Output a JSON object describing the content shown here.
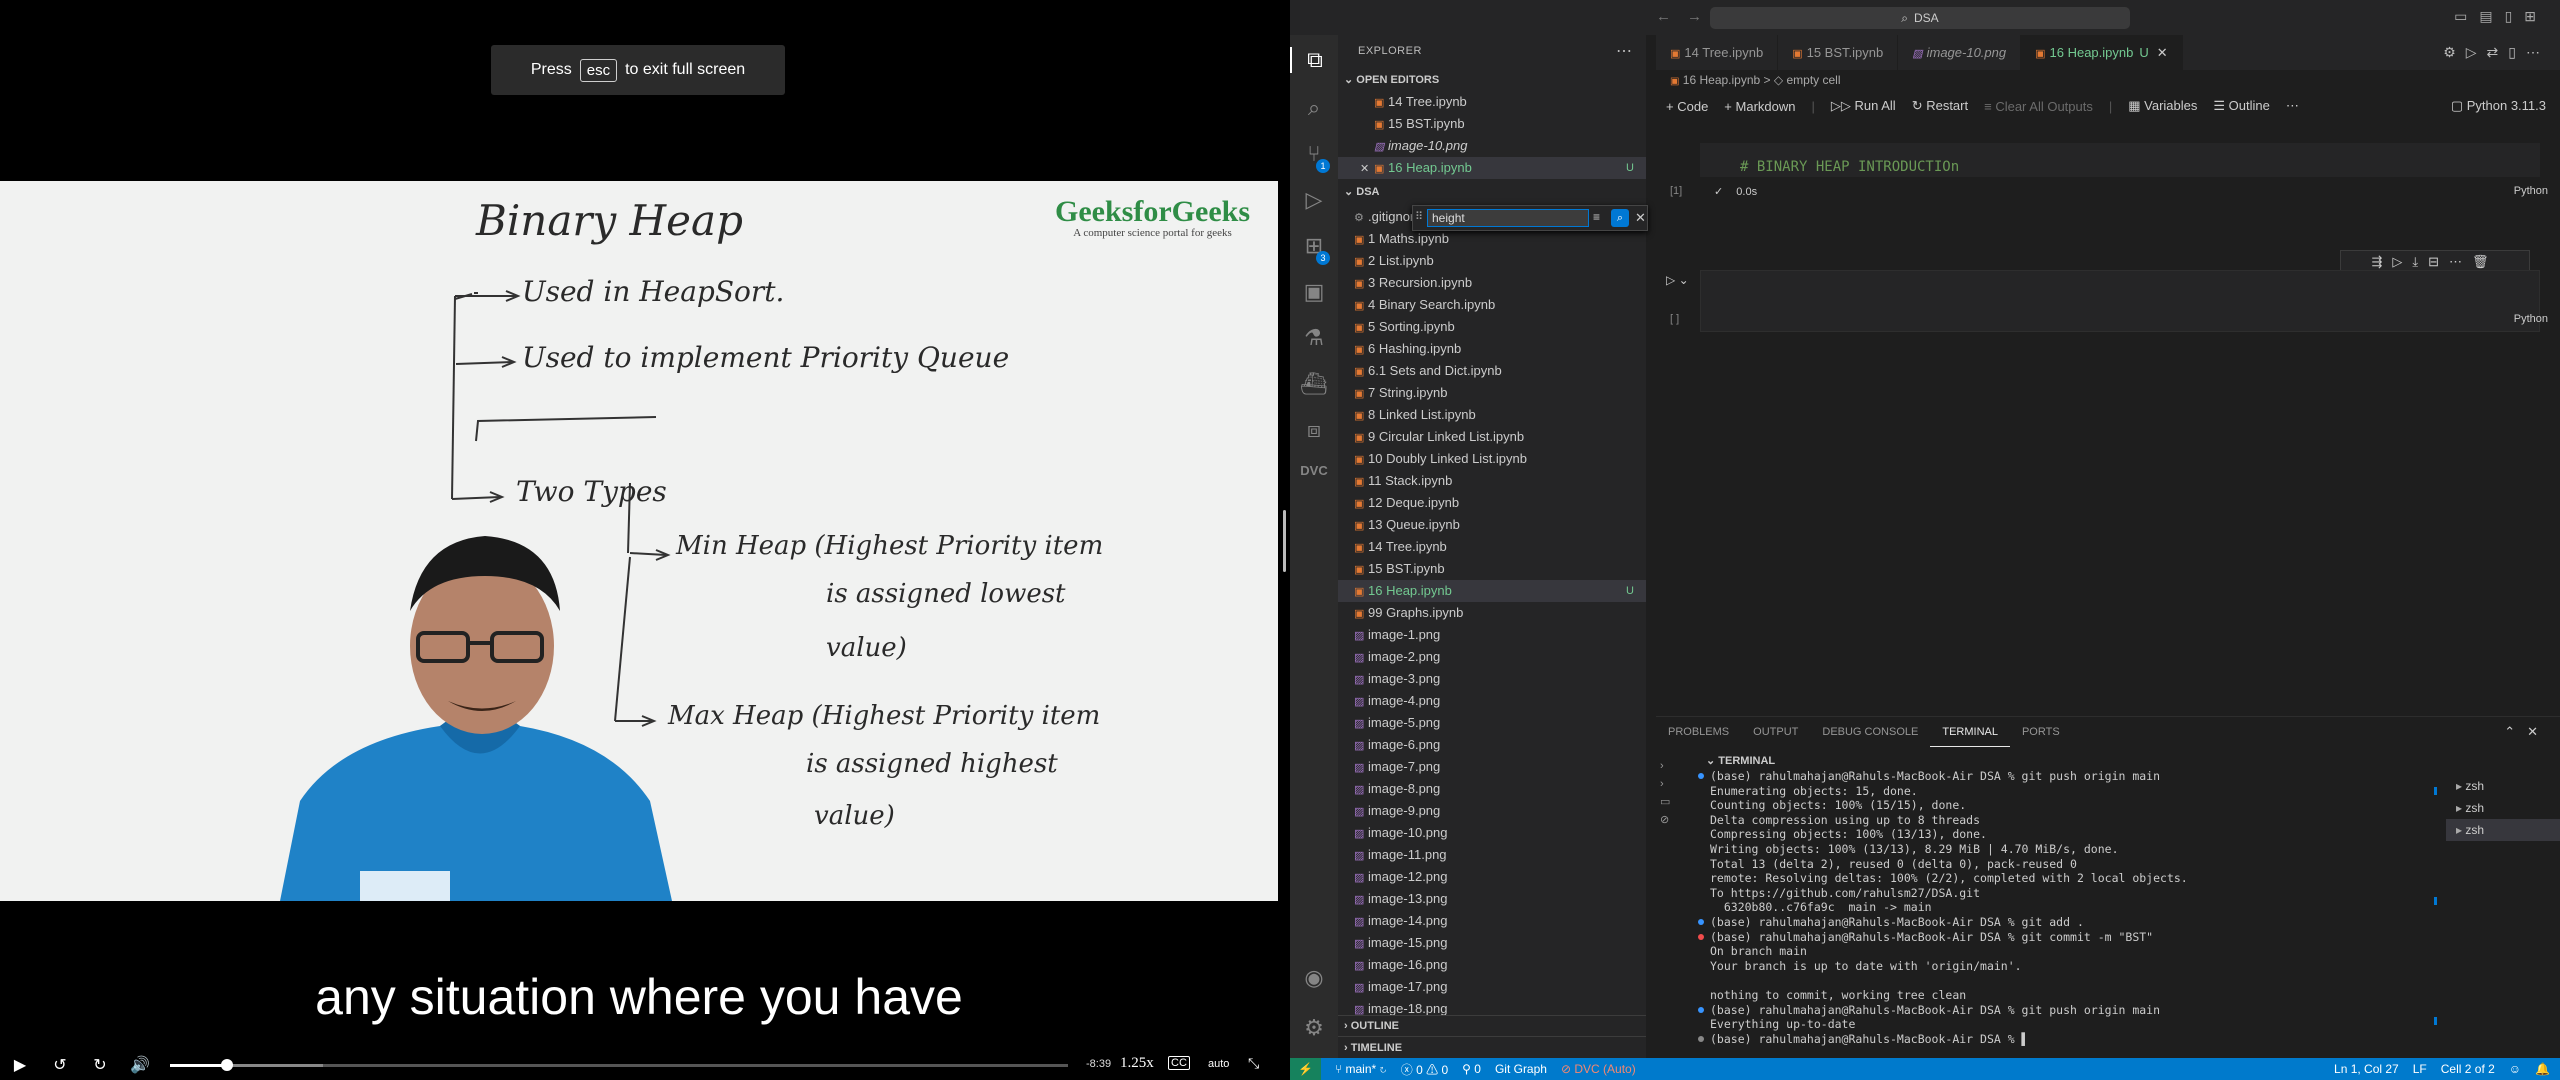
{
  "player": {
    "esc_prefix": "Press",
    "esc_key": "esc",
    "esc_suffix": "to exit full screen",
    "brand_name": "GeeksforGeeks",
    "brand_tagline": "A computer science portal for geeks",
    "whiteboard": {
      "title": "Binary Heap",
      "line1": "Used in HeapSort.",
      "line2": "Used to implement Priority Queue",
      "line3": "Two Types",
      "min_heap_1": "Min Heap (Highest Priority item",
      "min_heap_2": "is assigned lowest",
      "min_heap_3": "value)",
      "max_heap_1": "Max Heap (Highest Priority item",
      "max_heap_2": "is assigned highest",
      "max_heap_3": "value)"
    },
    "subtitle": "any situation where you have",
    "time_remaining": "-8:39",
    "speed": "1.25x",
    "cc_label": "CC",
    "quality": "auto",
    "progress_fraction": 0.063,
    "buffered_fraction": 0.17
  },
  "vscode": {
    "search_text": "DSA",
    "explorer_title": "EXPLORER",
    "open_editors_label": "OPEN EDITORS",
    "open_editors": [
      {
        "label": "14 Tree.ipynb",
        "kind": "notebook"
      },
      {
        "label": "15 BST.ipynb",
        "kind": "notebook"
      },
      {
        "label": "image-10.png",
        "kind": "image"
      },
      {
        "label": "16 Heap.ipynb",
        "kind": "notebook",
        "badge": "U"
      }
    ],
    "folder_label": "DSA",
    "files": [
      ".gitignore",
      "1 Maths.ipynb",
      "2 List.ipynb",
      "3 Recursion.ipynb",
      "4 Binary Search.ipynb",
      "5 Sorting.ipynb",
      "6 Hashing.ipynb",
      "6.1 Sets and Dict.ipynb",
      "7 String.ipynb",
      "8 Linked List.ipynb",
      "9 Circular Linked List.ipynb",
      "10 Doubly Linked List.ipynb",
      "11 Stack.ipynb",
      "12 Deque.ipynb",
      "13 Queue.ipynb",
      "14 Tree.ipynb",
      "15 BST.ipynb",
      "16 Heap.ipynb",
      "99 Graphs.ipynb",
      "image-1.png",
      "image-2.png",
      "image-3.png",
      "image-4.png",
      "image-5.png",
      "image-6.png",
      "image-7.png",
      "image-8.png",
      "image-9.png",
      "image-10.png",
      "image-11.png",
      "image-12.png",
      "image-13.png",
      "image-14.png",
      "image-15.png",
      "image-16.png",
      "image-17.png",
      "image-18.png"
    ],
    "selected_file_badge": "U",
    "find_value": "height",
    "tabs": [
      {
        "label": "14 Tree.ipynb",
        "kind": "notebook"
      },
      {
        "label": "15 BST.ipynb",
        "kind": "notebook"
      },
      {
        "label": "image-10.png",
        "kind": "image"
      },
      {
        "label": "16 Heap.ipynb",
        "kind": "notebook",
        "badge": "U"
      }
    ],
    "breadcrumb": {
      "file": "16 Heap.ipynb",
      "sep": ">",
      "cell": "empty cell"
    },
    "toolbar": {
      "code": "Code",
      "markdown": "Markdown",
      "run_all": "Run All",
      "restart": "Restart",
      "clear": "Clear All Outputs",
      "variables": "Variables",
      "outline": "Outline",
      "kernel": "Python 3.11.3"
    },
    "cell1": {
      "source": "# BINARY HEAP INTRODUCTIOn",
      "count": "[1]",
      "time": "0.0s",
      "lang": "Python"
    },
    "cell2": {
      "count": "[ ]",
      "lang": "Python"
    },
    "panel_tabs": [
      "PROBLEMS",
      "OUTPUT",
      "DEBUG CONSOLE",
      "TERMINAL",
      "PORTS"
    ],
    "terminal_title": "TERMINAL",
    "terminal_lines": [
      {
        "text": "(base) rahulmahajan@Rahuls-MacBook-Air DSA % git push origin main",
        "dot": "blue"
      },
      {
        "text": "Enumerating objects: 15, done.",
        "dot": ""
      },
      {
        "text": "Counting objects: 100% (15/15), done.",
        "dot": ""
      },
      {
        "text": "Delta compression using up to 8 threads",
        "dot": ""
      },
      {
        "text": "Compressing objects: 100% (13/13), done.",
        "dot": ""
      },
      {
        "text": "Writing objects: 100% (13/13), 8.29 MiB | 4.70 MiB/s, done.",
        "dot": ""
      },
      {
        "text": "Total 13 (delta 2), reused 0 (delta 0), pack-reused 0",
        "dot": ""
      },
      {
        "text": "remote: Resolving deltas: 100% (2/2), completed with 2 local objects.",
        "dot": ""
      },
      {
        "text": "To https://github.com/rahulsm27/DSA.git",
        "dot": ""
      },
      {
        "text": "  6320b80..c76fa9c  main -> main",
        "dot": ""
      },
      {
        "text": "(base) rahulmahajan@Rahuls-MacBook-Air DSA % git add .",
        "dot": "blue"
      },
      {
        "text": "(base) rahulmahajan@Rahuls-MacBook-Air DSA % git commit -m \"BST\"",
        "dot": "red"
      },
      {
        "text": "On branch main",
        "dot": ""
      },
      {
        "text": "Your branch is up to date with 'origin/main'.",
        "dot": ""
      },
      {
        "text": "",
        "dot": ""
      },
      {
        "text": "nothing to commit, working tree clean",
        "dot": ""
      },
      {
        "text": "(base) rahulmahajan@Rahuls-MacBook-Air DSA % git push origin main",
        "dot": "blue"
      },
      {
        "text": "Everything up-to-date",
        "dot": ""
      },
      {
        "text": "(base) rahulmahajan@Rahuls-MacBook-Air DSA % ▌",
        "dot": "grey"
      }
    ],
    "terminal_instances": [
      "zsh",
      "zsh",
      "zsh"
    ],
    "outline_label": "OUTLINE",
    "timeline_label": "TIMELINE",
    "status": {
      "branch": "main*",
      "errors": "0",
      "warnings": "0",
      "ports": "0",
      "git_graph": "Git Graph",
      "dvc": "DVC (Auto)",
      "position": "Ln 1, Col 27",
      "eol": "LF",
      "cell": "Cell 2 of 2"
    },
    "colors": {
      "accent": "#007acc",
      "modified": "#73c991",
      "notebook_icon": "#e37933",
      "image_icon": "#a074c4"
    }
  }
}
